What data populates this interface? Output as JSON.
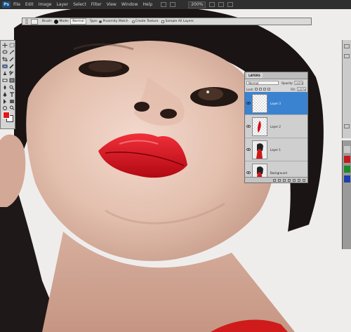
{
  "app": {
    "logo": "Ps"
  },
  "menu": {
    "items": [
      "File",
      "Edit",
      "Image",
      "Layer",
      "Select",
      "Filter",
      "View",
      "Window",
      "Help"
    ],
    "zoom": "200%"
  },
  "options": {
    "brush_label": "Brush:",
    "mode_label": "Mode:",
    "mode_value": "Normal",
    "type_label": "Type:",
    "type_options": [
      "Proximity Match",
      "Create Texture"
    ],
    "sample_all_layers": "Sample All Layers"
  },
  "tools": {
    "foreground_color": "#e01818",
    "background_color": "#ffffff"
  },
  "layers_panel": {
    "tab": "LAYERS",
    "blend_mode": "Normal",
    "opacity_label": "Opacity:",
    "opacity": "100%",
    "lock_label": "Lock:",
    "fill_label": "Fill:",
    "fill": "100%",
    "layers": [
      {
        "name": "Layer 3",
        "selected": true,
        "thumb": "transparent"
      },
      {
        "name": "Layer 2",
        "selected": false,
        "thumb": "lips"
      },
      {
        "name": "Layer 1",
        "selected": false,
        "thumb": "photo"
      },
      {
        "name": "Background",
        "selected": false,
        "thumb": "photo"
      }
    ]
  },
  "colors": {
    "selection": "#3a83d1",
    "lips": "#d4101c"
  }
}
